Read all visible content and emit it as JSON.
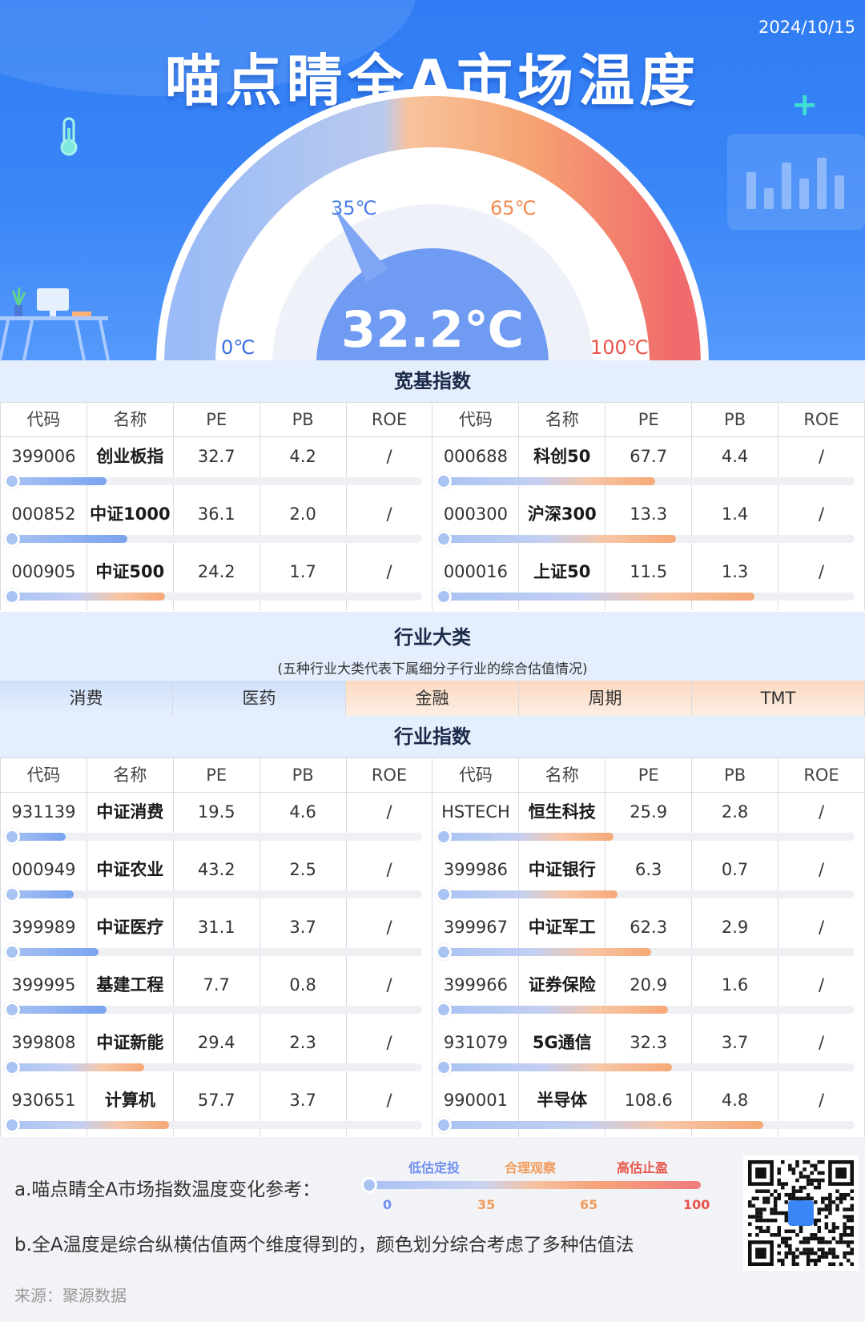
{
  "header": {
    "date": "2024/10/15",
    "title": "喵点睛全A市场温度",
    "gauge_min_label": "0℃",
    "gauge_max_label": "100℃",
    "mark_low_label": "35℃",
    "mark_high_label": "65℃",
    "temperature_value": 32.2,
    "temperature_label": "32.2℃"
  },
  "broad_index": {
    "title": "宽基指数",
    "columns": [
      "代码",
      "名称",
      "PE",
      "PB",
      "ROE",
      "代码",
      "名称",
      "PE",
      "PB",
      "ROE"
    ],
    "rows": [
      {
        "left": {
          "code": "399006",
          "name": "创业板指",
          "pe": "32.7",
          "pb": "4.2",
          "roe": "/",
          "level": 0.24
        },
        "right": {
          "code": "000688",
          "name": "科创50",
          "pe": "67.7",
          "pb": "4.4",
          "roe": "/",
          "level": 0.52
        }
      },
      {
        "left": {
          "code": "000852",
          "name": "中证1000",
          "pe": "36.1",
          "pb": "2.0",
          "roe": "/",
          "level": 0.29
        },
        "right": {
          "code": "000300",
          "name": "沪深300",
          "pe": "13.3",
          "pb": "1.4",
          "roe": "/",
          "level": 0.57
        }
      },
      {
        "left": {
          "code": "000905",
          "name": "中证500",
          "pe": "24.2",
          "pb": "1.7",
          "roe": "/",
          "level": 0.38
        },
        "right": {
          "code": "000016",
          "name": "上证50",
          "pe": "11.5",
          "pb": "1.3",
          "roe": "/",
          "level": 0.76
        }
      }
    ]
  },
  "industry_major": {
    "title": "行业大类",
    "note": "(五种行业大类代表下属细分子行业的综合估值情况)",
    "categories": [
      "消费",
      "医药",
      "金融",
      "周期",
      "TMT"
    ]
  },
  "industry_index": {
    "title": "行业指数",
    "columns": [
      "代码",
      "名称",
      "PE",
      "PB",
      "ROE",
      "代码",
      "名称",
      "PE",
      "PB",
      "ROE"
    ],
    "rows": [
      {
        "left": {
          "code": "931139",
          "name": "中证消费",
          "pe": "19.5",
          "pb": "4.6",
          "roe": "/",
          "level": 0.14
        },
        "right": {
          "code": "HSTECH",
          "name": "恒生科技",
          "pe": "25.9",
          "pb": "2.8",
          "roe": "/",
          "level": 0.42
        }
      },
      {
        "left": {
          "code": "000949",
          "name": "中证农业",
          "pe": "43.2",
          "pb": "2.5",
          "roe": "/",
          "level": 0.16
        },
        "right": {
          "code": "399986",
          "name": "中证银行",
          "pe": "6.3",
          "pb": "0.7",
          "roe": "/",
          "level": 0.43
        }
      },
      {
        "left": {
          "code": "399989",
          "name": "中证医疗",
          "pe": "31.1",
          "pb": "3.7",
          "roe": "/",
          "level": 0.22
        },
        "right": {
          "code": "399967",
          "name": "中证军工",
          "pe": "62.3",
          "pb": "2.9",
          "roe": "/",
          "level": 0.51
        }
      },
      {
        "left": {
          "code": "399995",
          "name": "基建工程",
          "pe": "7.7",
          "pb": "0.8",
          "roe": "/",
          "level": 0.24
        },
        "right": {
          "code": "399966",
          "name": "证券保险",
          "pe": "20.9",
          "pb": "1.6",
          "roe": "/",
          "level": 0.55
        }
      },
      {
        "left": {
          "code": "399808",
          "name": "中证新能",
          "pe": "29.4",
          "pb": "2.3",
          "roe": "/",
          "level": 0.33
        },
        "right": {
          "code": "931079",
          "name": "5G通信",
          "pe": "32.3",
          "pb": "3.7",
          "roe": "/",
          "level": 0.56
        }
      },
      {
        "left": {
          "code": "930651",
          "name": "计算机",
          "pe": "57.7",
          "pb": "3.7",
          "roe": "/",
          "level": 0.39
        },
        "right": {
          "code": "990001",
          "name": "半导体",
          "pe": "108.6",
          "pb": "4.8",
          "roe": "/",
          "level": 0.78
        }
      }
    ]
  },
  "footer": {
    "note_a": "a.喵点睛全A市场指数温度变化参考：",
    "note_b": "b.全A温度是综合纵横估值两个维度得到的，颜色划分综合考虑了多种估值法",
    "scale_labels": [
      "低估定投",
      "合理观察",
      "高估止盈"
    ],
    "scale_ticks": [
      "0",
      "35",
      "65",
      "100"
    ],
    "source": "来源：聚源数据"
  },
  "colors": {
    "header_blue": "#3a86f7",
    "cool": "#7aa3ef",
    "warm": "#f5a877",
    "hot": "#f06b6b",
    "low_text": "#6f8ff0",
    "mid_text": "#f29a5c",
    "high_text": "#e8534a"
  }
}
